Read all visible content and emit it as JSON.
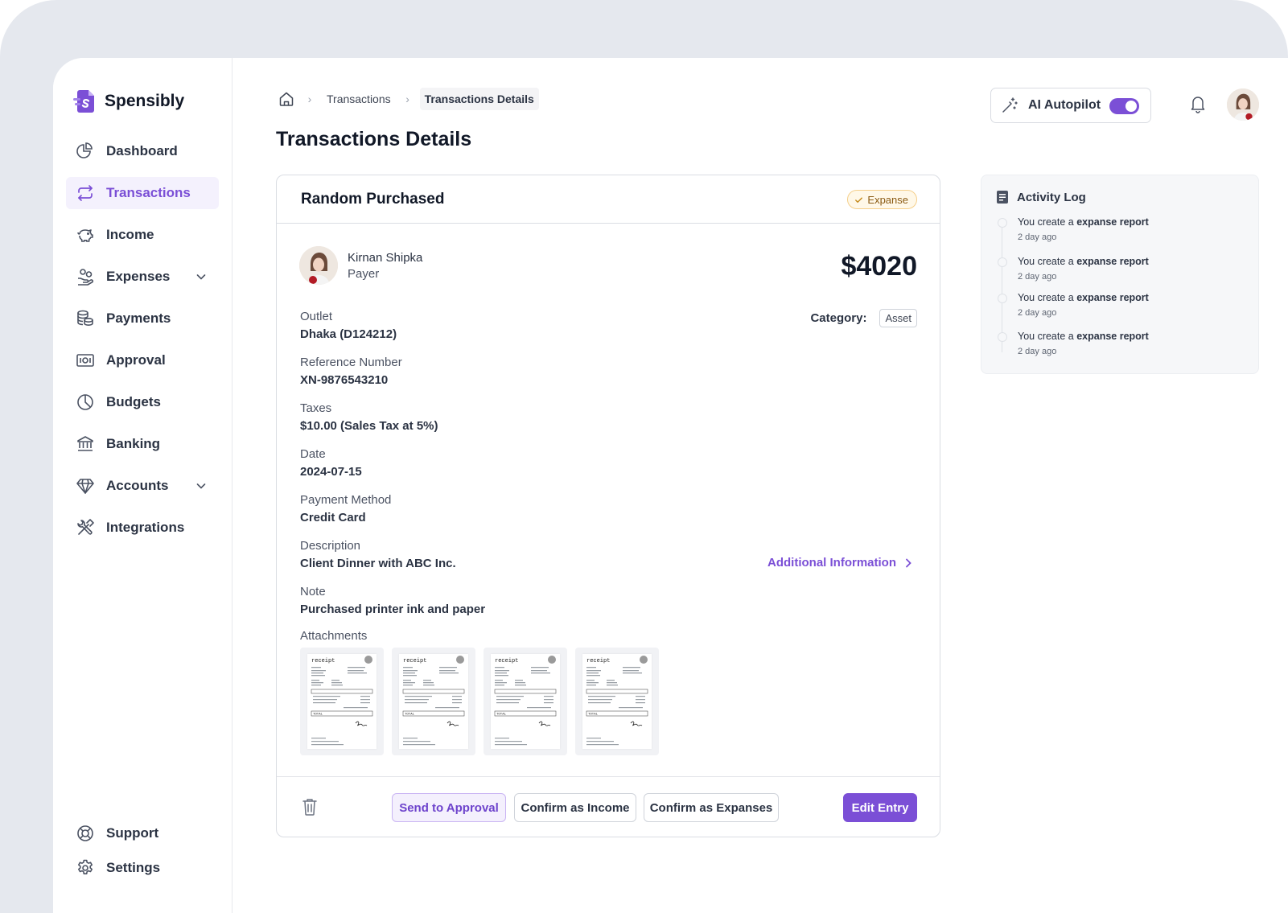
{
  "app": {
    "name": "Spensibly"
  },
  "sidebar": {
    "items": [
      {
        "label": "Dashboard",
        "icon": "pie-chart-icon"
      },
      {
        "label": "Transactions",
        "icon": "arrows-exchange-icon",
        "active": true
      },
      {
        "label": "Income",
        "icon": "piggy-bank-icon"
      },
      {
        "label": "Expenses",
        "icon": "hand-coins-icon",
        "expandable": true
      },
      {
        "label": "Payments",
        "icon": "coins-stack-icon"
      },
      {
        "label": "Approval",
        "icon": "banknote-icon"
      },
      {
        "label": "Budgets",
        "icon": "pie-icon"
      },
      {
        "label": "Banking",
        "icon": "bank-icon"
      },
      {
        "label": "Accounts",
        "icon": "diamond-icon",
        "expandable": true
      },
      {
        "label": "Integrations",
        "icon": "tools-icon"
      }
    ],
    "bottom": [
      {
        "label": "Support",
        "icon": "lifebuoy-icon"
      },
      {
        "label": "Settings",
        "icon": "gear-icon"
      }
    ]
  },
  "breadcrumb": {
    "items": [
      "Transactions",
      "Transactions Details"
    ]
  },
  "page": {
    "title": "Transactions Details"
  },
  "header": {
    "autopilot_label": "AI Autopilot",
    "autopilot_on": true
  },
  "transaction": {
    "title": "Random Purchased",
    "type_badge": "Expanse",
    "payer_name": "Kirnan Shipka",
    "payer_role": "Payer",
    "amount": "$4020",
    "category_label": "Category:",
    "category_value": "Asset",
    "fields": [
      {
        "label": "Outlet",
        "value": "Dhaka (D124212)"
      },
      {
        "label": "Reference Number",
        "value": "XN-9876543210"
      },
      {
        "label": "Taxes",
        "value": "$10.00 (Sales Tax at 5%)"
      },
      {
        "label": "Date",
        "value": "2024-07-15"
      },
      {
        "label": "Payment Method",
        "value": "Credit Card"
      },
      {
        "label": "Description",
        "value": "Client Dinner with ABC Inc."
      },
      {
        "label": "Note",
        "value": "Purchased printer ink and paper"
      }
    ],
    "additional_info_label": "Additional Information",
    "attachments_label": "Attachments",
    "attachments": [
      {
        "title": "receipt",
        "total_label": "TOTAL"
      },
      {
        "title": "receipt",
        "total_label": "TOTAL"
      },
      {
        "title": "receipt",
        "total_label": "TOTAL"
      },
      {
        "title": "receipt",
        "total_label": "TOTAL"
      }
    ]
  },
  "actions": {
    "send_approval": "Send to Approval",
    "confirm_income": "Confirm as Income",
    "confirm_expanses": "Confirm as Expanses",
    "edit": "Edit Entry"
  },
  "activity": {
    "title": "Activity Log",
    "items": [
      {
        "prefix": "You create a ",
        "bold": "expanse report",
        "time": "2 day ago"
      },
      {
        "prefix": "You create a ",
        "bold": "expanse report",
        "time": "2 day ago"
      },
      {
        "prefix": "You create a ",
        "bold": "expanse report",
        "time": "2 day ago"
      },
      {
        "prefix": "You create a ",
        "bold": "expanse report",
        "time": "2 day ago"
      }
    ]
  },
  "colors": {
    "accent": "#7b4fd6",
    "badge_bg": "#fff8e8",
    "badge_border": "#f5cf8a"
  }
}
